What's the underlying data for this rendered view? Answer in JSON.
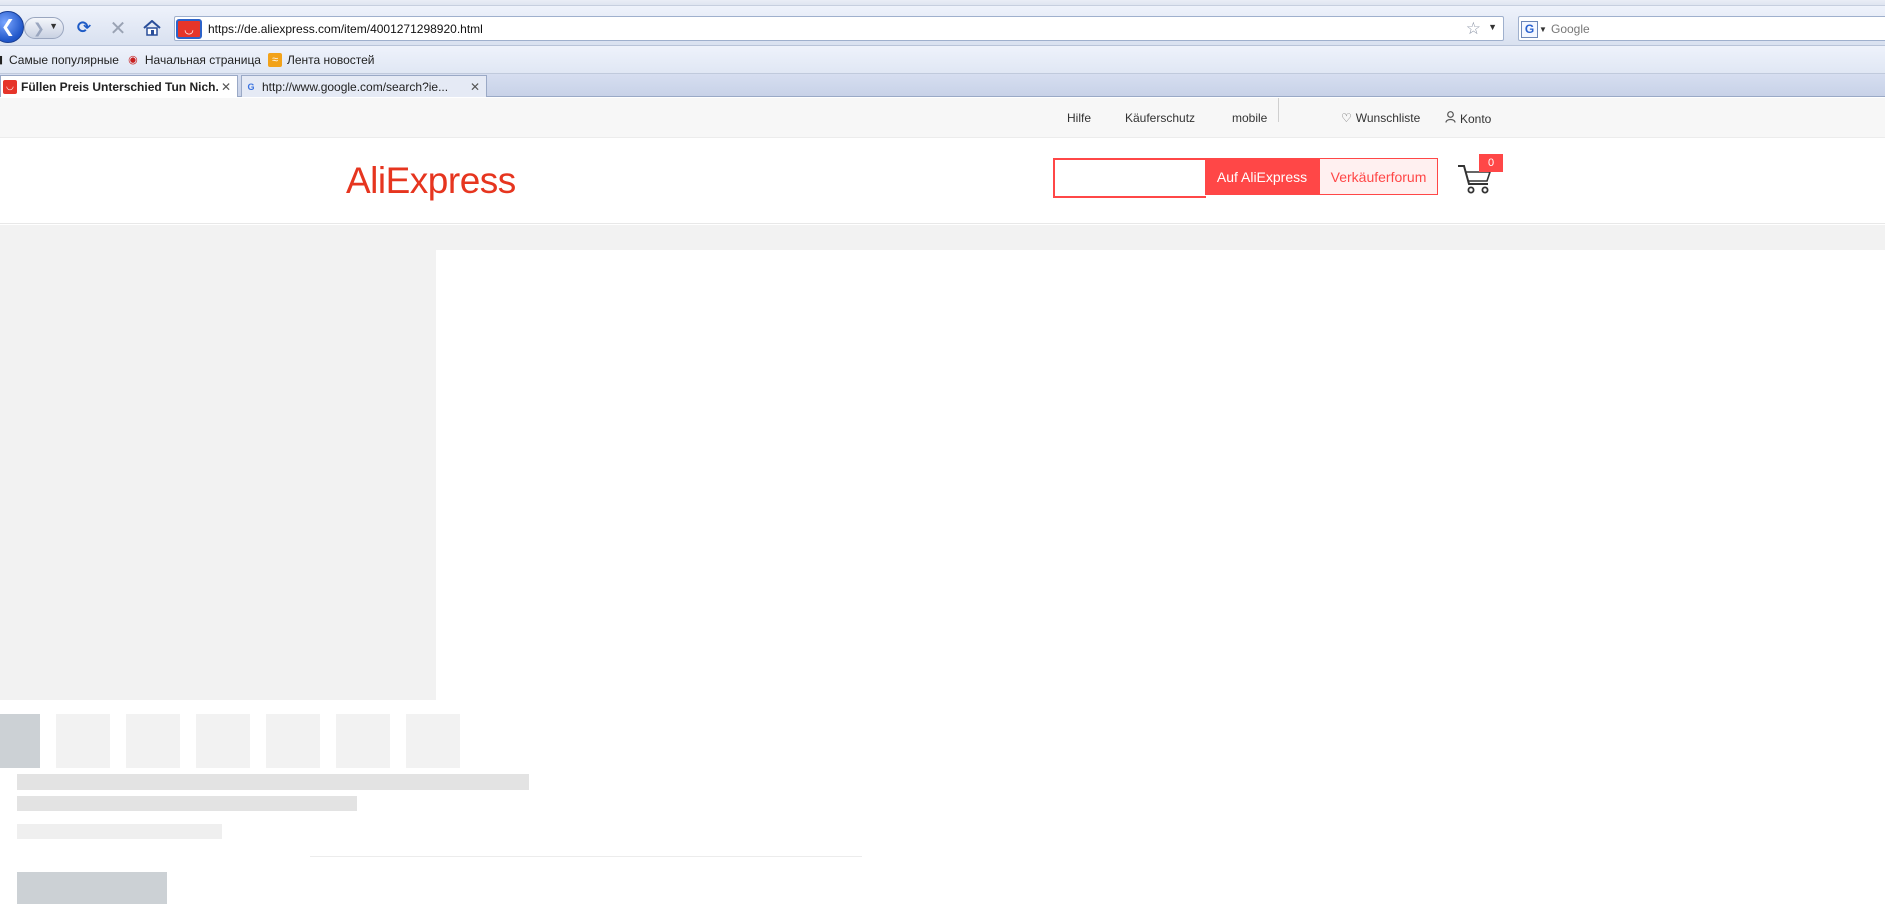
{
  "browser": {
    "url": "https://de.aliexpress.com/item/4001271298920.html",
    "search_placeholder": "Google",
    "bookmarks": [
      {
        "label": "Самые популярные",
        "icon": "page-icon"
      },
      {
        "label": "Начальная страница",
        "icon": "home-page-icon"
      },
      {
        "label": "Лента новостей",
        "icon": "rss-icon"
      }
    ],
    "tabs": [
      {
        "label": "Füllen Preis Unterschied Tun Nich...",
        "active": true,
        "icon": "aliexpress-favicon"
      },
      {
        "label": "http://www.google.com/search?ie...",
        "active": false,
        "icon": "google-favicon"
      }
    ],
    "close_glyph": "✕"
  },
  "topbar": {
    "links": {
      "hilfe": "Hilfe",
      "kauferschutz": "Käuferschutz",
      "mobile": "mobile",
      "wunschliste": "Wunschliste",
      "konto": "Konto"
    }
  },
  "header": {
    "logo": "AliExpress",
    "search_value": "",
    "btn_search_aliexpress": "Auf AliExpress",
    "btn_seller_forum": "Verkäuferforum",
    "cart_count": "0"
  },
  "colors": {
    "brand": "#ff4747",
    "logo": "#e6351f",
    "skeleton": "#f2f2f2"
  }
}
